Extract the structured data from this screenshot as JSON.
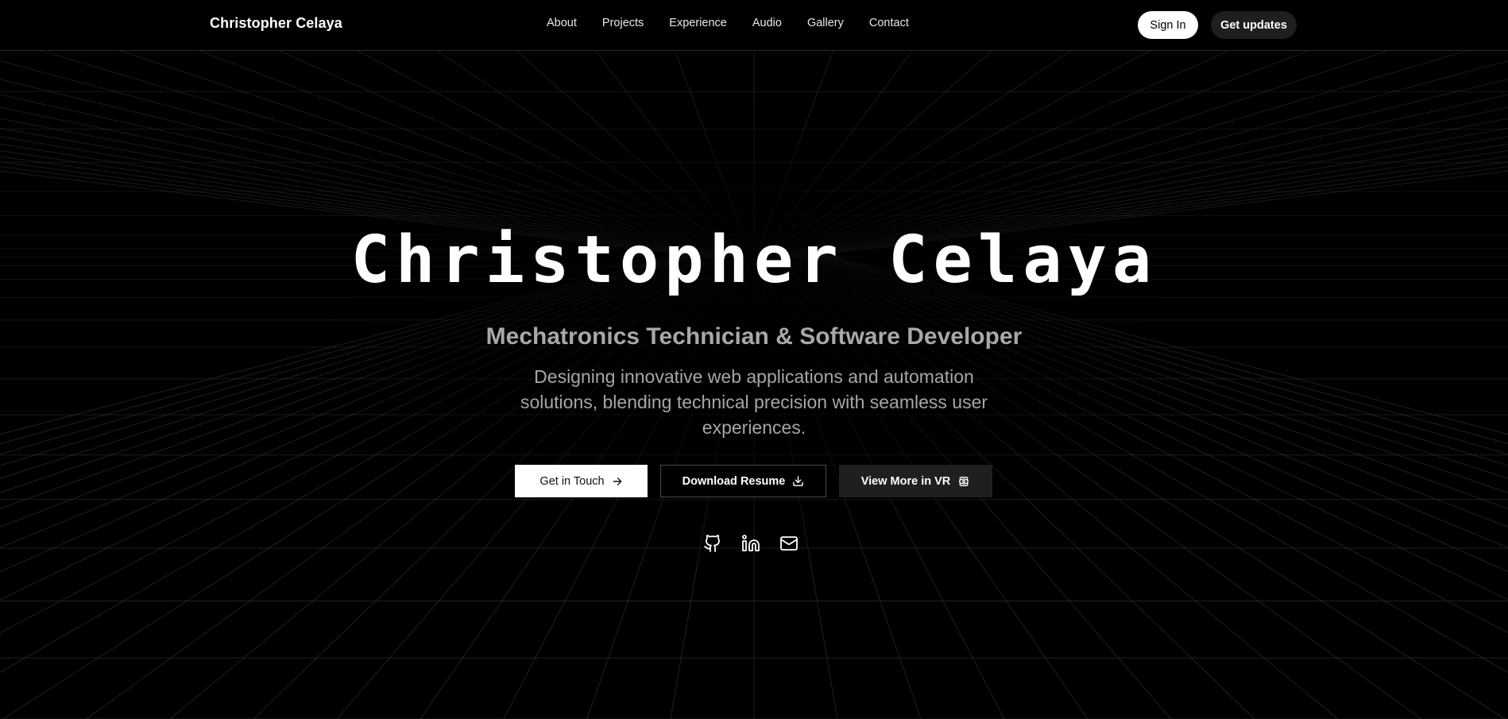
{
  "header": {
    "brand": "Christopher Celaya",
    "nav": [
      "About",
      "Projects",
      "Experience",
      "Audio",
      "Gallery",
      "Contact"
    ],
    "sign_in_label": "Sign In",
    "get_updates_label": "Get updates"
  },
  "hero": {
    "title": "Christopher Celaya",
    "subtitle": "Mechatronics Technician & Software Developer",
    "description": "Designing innovative web applications and automation solutions, blending technical precision with seamless user experiences.",
    "buttons": {
      "get_in_touch": "Get in Touch",
      "download_resume": "Download Resume",
      "view_vr": "View More in VR"
    },
    "icons": {
      "get_in_touch": "arrow-right-icon",
      "download_resume": "download-icon",
      "view_vr": "vr-eye-icon"
    }
  },
  "socials": [
    {
      "icon": "github-icon"
    },
    {
      "icon": "linkedin-icon"
    },
    {
      "icon": "mail-icon"
    }
  ],
  "colors": {
    "background": "#000000",
    "grid_line": "#3a3a3a",
    "muted_text": "#a8a8a8",
    "secondary_button": "#1f1f1f"
  }
}
